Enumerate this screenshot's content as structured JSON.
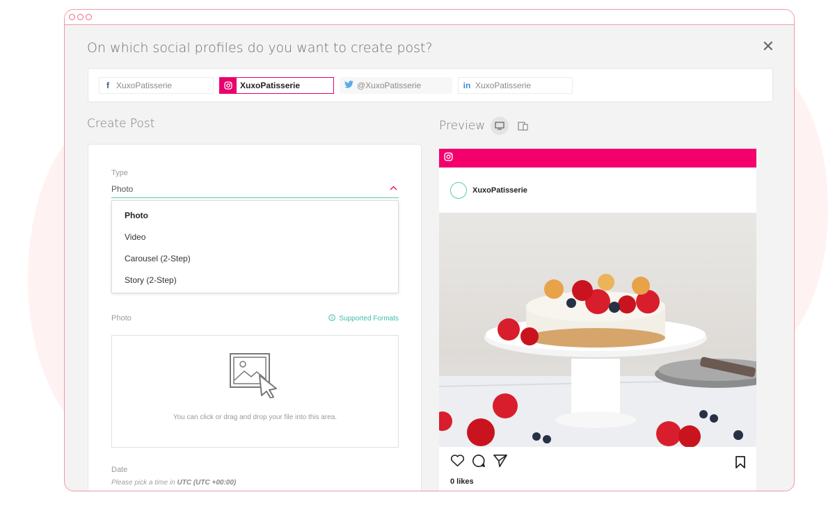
{
  "window": {
    "heading": "On which social profiles do you want to create post?"
  },
  "profiles": [
    {
      "icon": "facebook-icon",
      "glyph": "f",
      "name": "XuxoPatisserie",
      "active": false,
      "color": "#3b5998"
    },
    {
      "icon": "instagram-icon",
      "glyph": "◎",
      "name": "XuxoPatisserie",
      "active": true,
      "color": "#e8006b"
    },
    {
      "icon": "twitter-icon",
      "glyph": "🐦",
      "name": "@XuxoPatisserie",
      "active": false,
      "color": "#55acee"
    },
    {
      "icon": "linkedin-icon",
      "glyph": "in",
      "name": "XuxoPatisserie",
      "active": false,
      "color": "#3b8ad9"
    }
  ],
  "create_post": {
    "title": "Create Post",
    "type_label": "Type",
    "type_value": "Photo",
    "options": [
      "Photo",
      "Video",
      "Carousel (2-Step)",
      "Story (2-Step)"
    ],
    "photo_label": "Photo",
    "supported_formats": "Supported Formats",
    "drop_text": "You can click or drag and drop your file into this area.",
    "date_label": "Date",
    "date_hint_prefix": "Please pick a time in ",
    "date_hint_tz": "UTC (UTC +00:00)"
  },
  "preview": {
    "title": "Preview",
    "username": "XuxoPatisserie",
    "likes": "0 likes",
    "brand_color": "#f3006d"
  }
}
